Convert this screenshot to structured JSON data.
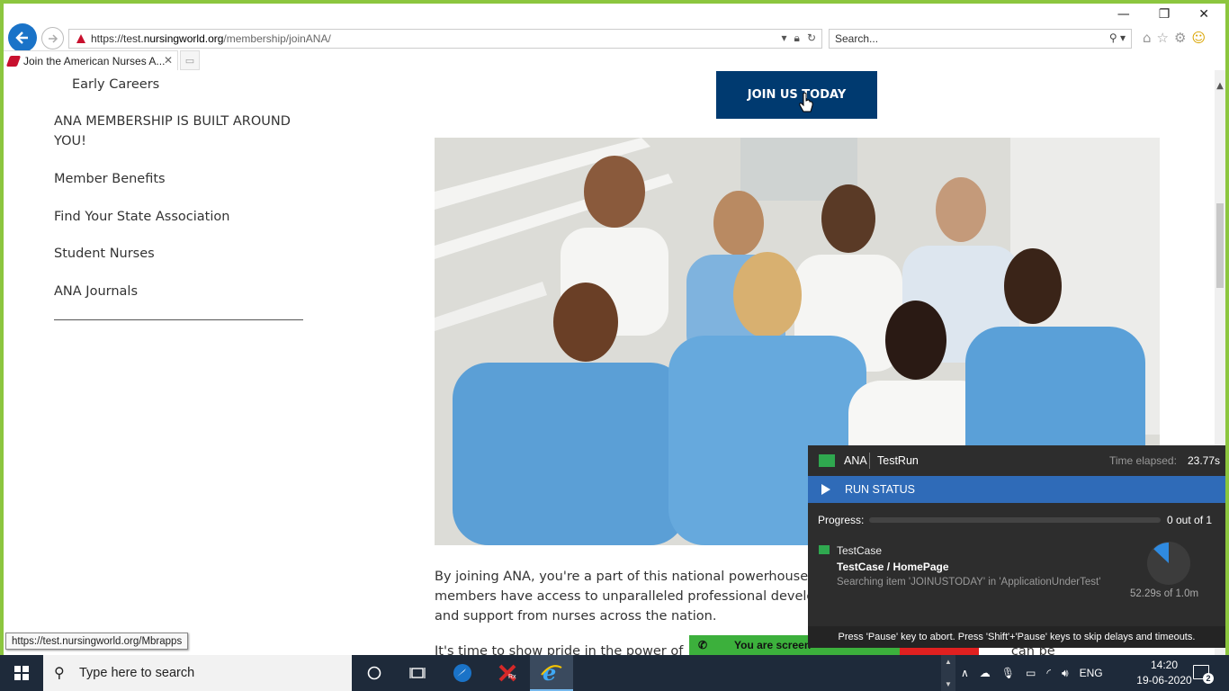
{
  "browser": {
    "url_prefix": "https://test.",
    "url_domain": "nursingworld.org",
    "url_path": "/membership/joinANA/",
    "search_placeholder": "Search...",
    "tab_title": "Join the American Nurses A...",
    "status_url": "https://test.nursingworld.org/Mbrapps"
  },
  "sidebar": {
    "sub_item": "Early Careers",
    "items": [
      {
        "label": "ANA MEMBERSHIP IS BUILT AROUND YOU!"
      },
      {
        "label": "Member Benefits"
      },
      {
        "label": "Find Your State Association"
      },
      {
        "label": "Student Nurses"
      },
      {
        "label": "ANA Journals"
      }
    ]
  },
  "main": {
    "join_button": "JOIN US TODAY",
    "paragraph_line1": "By joining ANA, you're a part of this national powerhouse",
    "paragraph_line2": "members have access to unparalleled professional develo",
    "paragraph_line3": "and support from nurses across the nation.",
    "paragraph2_start": "It's time to show pride in the power of",
    "paragraph2_end": "can be"
  },
  "share_notice": "You are screen",
  "testrun": {
    "project": "ANA",
    "title": "TestRun",
    "time_label": "Time elapsed:",
    "time_value": "23.77s",
    "run_status": "RUN STATUS",
    "progress_label": "Progress:",
    "progress_fraction": 0.0,
    "progress_value": "0 out of 1",
    "testcase_label": "TestCase",
    "testcase_path": "TestCase / HomePage",
    "action_text": "Searching item 'JOINUSTODAY' in 'ApplicationUnderTest'",
    "timer_fraction": 0.87,
    "timer_text": "52.29s of 1.0m",
    "footer": "Press 'Pause' key to abort. Press 'Shift'+'Pause' keys to skip delays and timeouts.",
    "colors": {
      "accent": "#2f6bb8",
      "flag": "#2fa84f"
    }
  },
  "taskbar": {
    "search_placeholder": "Type here to search",
    "language": "ENG",
    "time": "14:20",
    "date": "19-06-2020",
    "notification_count": "2"
  }
}
